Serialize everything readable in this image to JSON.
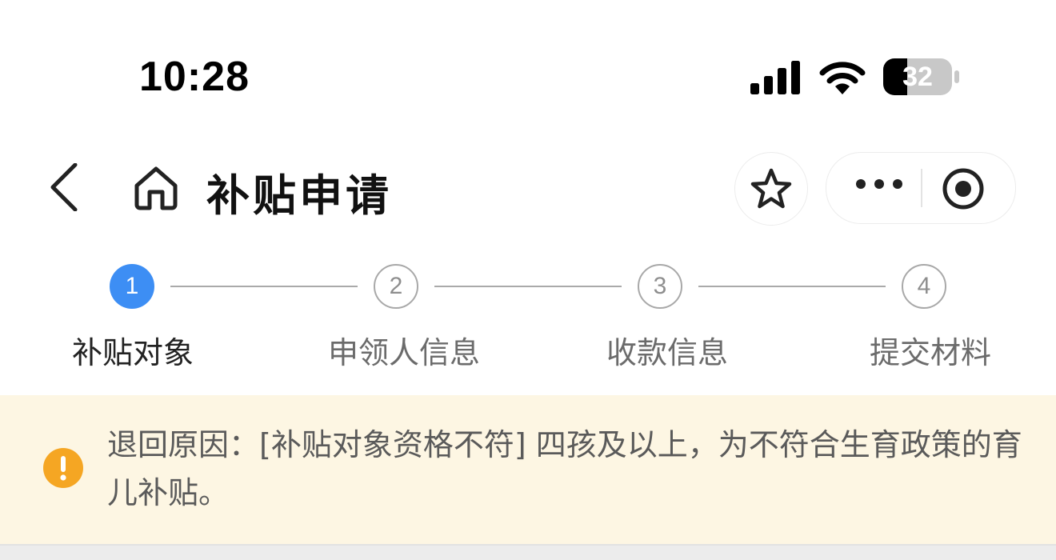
{
  "status_bar": {
    "time": "10:28",
    "battery_level": "32",
    "icons": [
      "signal-icon",
      "wifi-icon",
      "battery-icon"
    ]
  },
  "nav": {
    "title": "补贴申请",
    "icons": [
      "back-icon",
      "home-icon",
      "star-icon",
      "more-icon",
      "close-icon"
    ]
  },
  "stepper": {
    "current_step": 1,
    "steps": [
      {
        "number": "1",
        "label": "补贴对象"
      },
      {
        "number": "2",
        "label": "申领人信息"
      },
      {
        "number": "3",
        "label": "收款信息"
      },
      {
        "number": "4",
        "label": "提交材料"
      }
    ]
  },
  "notice": {
    "icon": "warning-icon",
    "text": "退回原因：[补贴对象资格不符] 四孩及以上，为不符合生育政策的育儿补贴。"
  },
  "colors": {
    "accent": "#3d8ef4",
    "notice_bg": "#fdf6e3",
    "warning": "#f5a623"
  }
}
